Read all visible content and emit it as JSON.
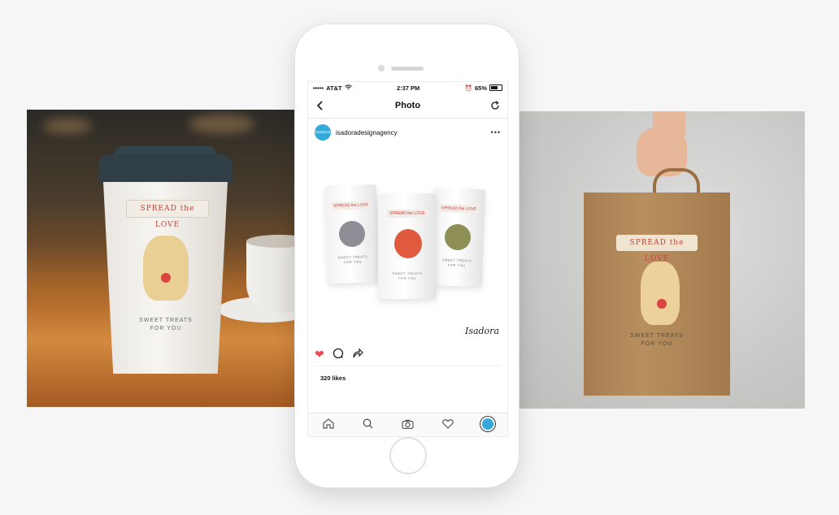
{
  "left_photo": {
    "banner_text": "SPREAD the LOVE",
    "tagline_line1": "SWEET TREATS",
    "tagline_line2": "FOR YOU"
  },
  "right_photo": {
    "banner_text": "SPREAD the LOVE",
    "tagline_line1": "SWEET TREATS",
    "tagline_line2": "FOR YOU"
  },
  "status_bar": {
    "signal": "•••••",
    "carrier": "AT&T",
    "time": "2:37 PM",
    "battery": "65%"
  },
  "nav": {
    "title": "Photo",
    "back_icon": "chevron-left-icon",
    "refresh_icon": "refresh-icon"
  },
  "post": {
    "avatar_text": "Isadora",
    "username": "isadoradesignagency",
    "more": "•••",
    "pouch_banner": "SPREAD the LOVE",
    "pouch_tag_line1": "SWEET TREATS",
    "pouch_tag_line2": "FOR YOU",
    "signature": "Isadora",
    "likes": "320 likes"
  },
  "colors": {
    "like_red": "#ed4956",
    "brand_blue": "#35a9d9"
  }
}
